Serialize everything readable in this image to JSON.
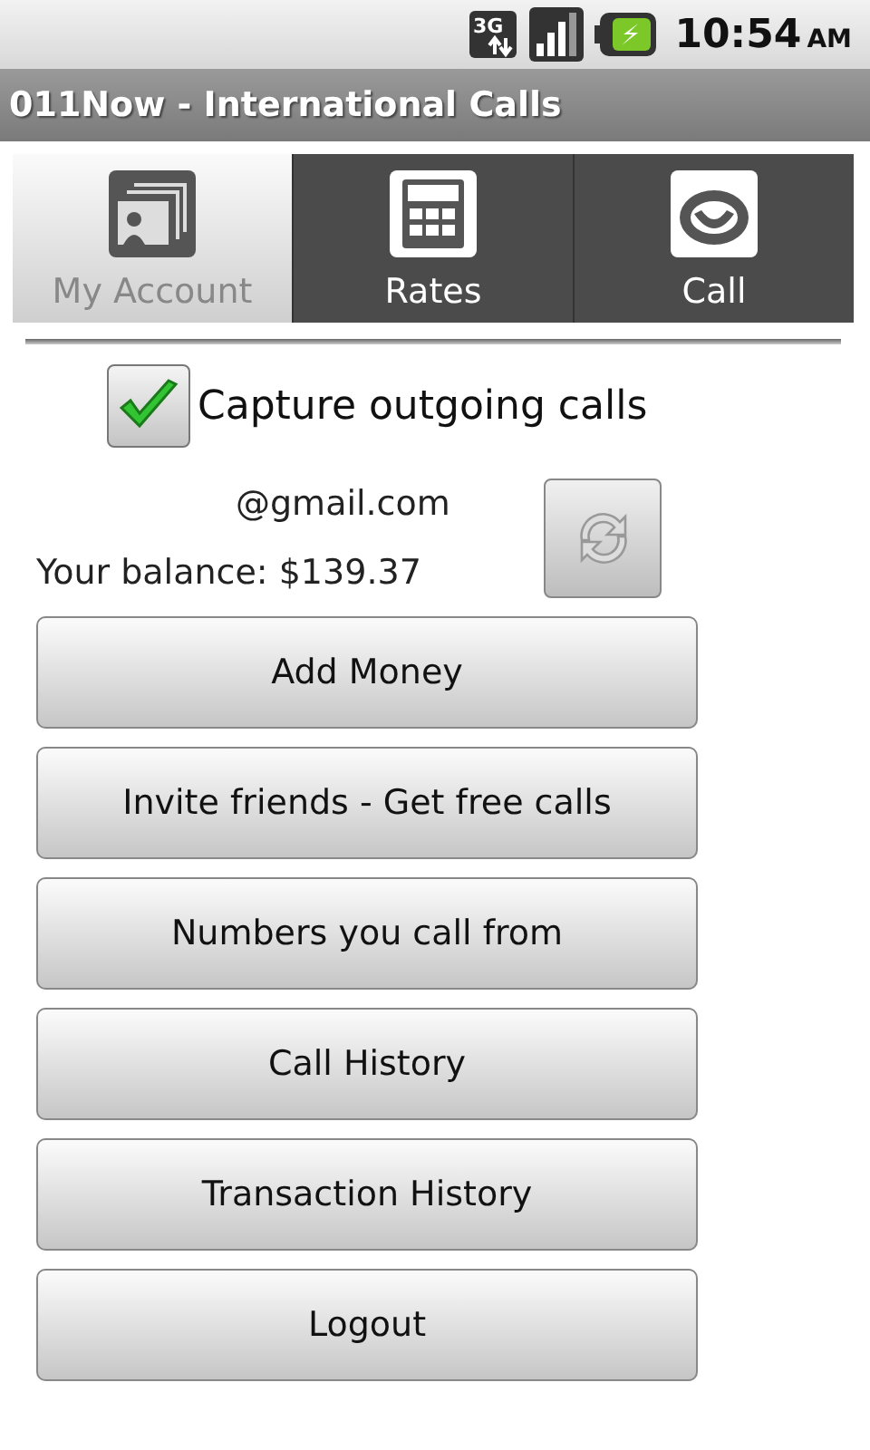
{
  "status_bar": {
    "network": "3G",
    "time": "10:54",
    "meridiem": "AM"
  },
  "window": {
    "title": "011Now - International Calls"
  },
  "tabs": [
    {
      "label": "My Account",
      "kind": "account",
      "selected": true
    },
    {
      "label": "Rates",
      "kind": "rates",
      "selected": false
    },
    {
      "label": "Call",
      "kind": "call",
      "selected": false
    }
  ],
  "capture": {
    "label": "Capture outgoing calls",
    "checked": true
  },
  "account": {
    "email": "@gmail.com",
    "balance": "Your balance: $139.37"
  },
  "buttons": [
    "Add Money",
    "Invite friends - Get free calls",
    "Numbers you call from",
    "Call History",
    "Transaction History",
    "Logout"
  ]
}
